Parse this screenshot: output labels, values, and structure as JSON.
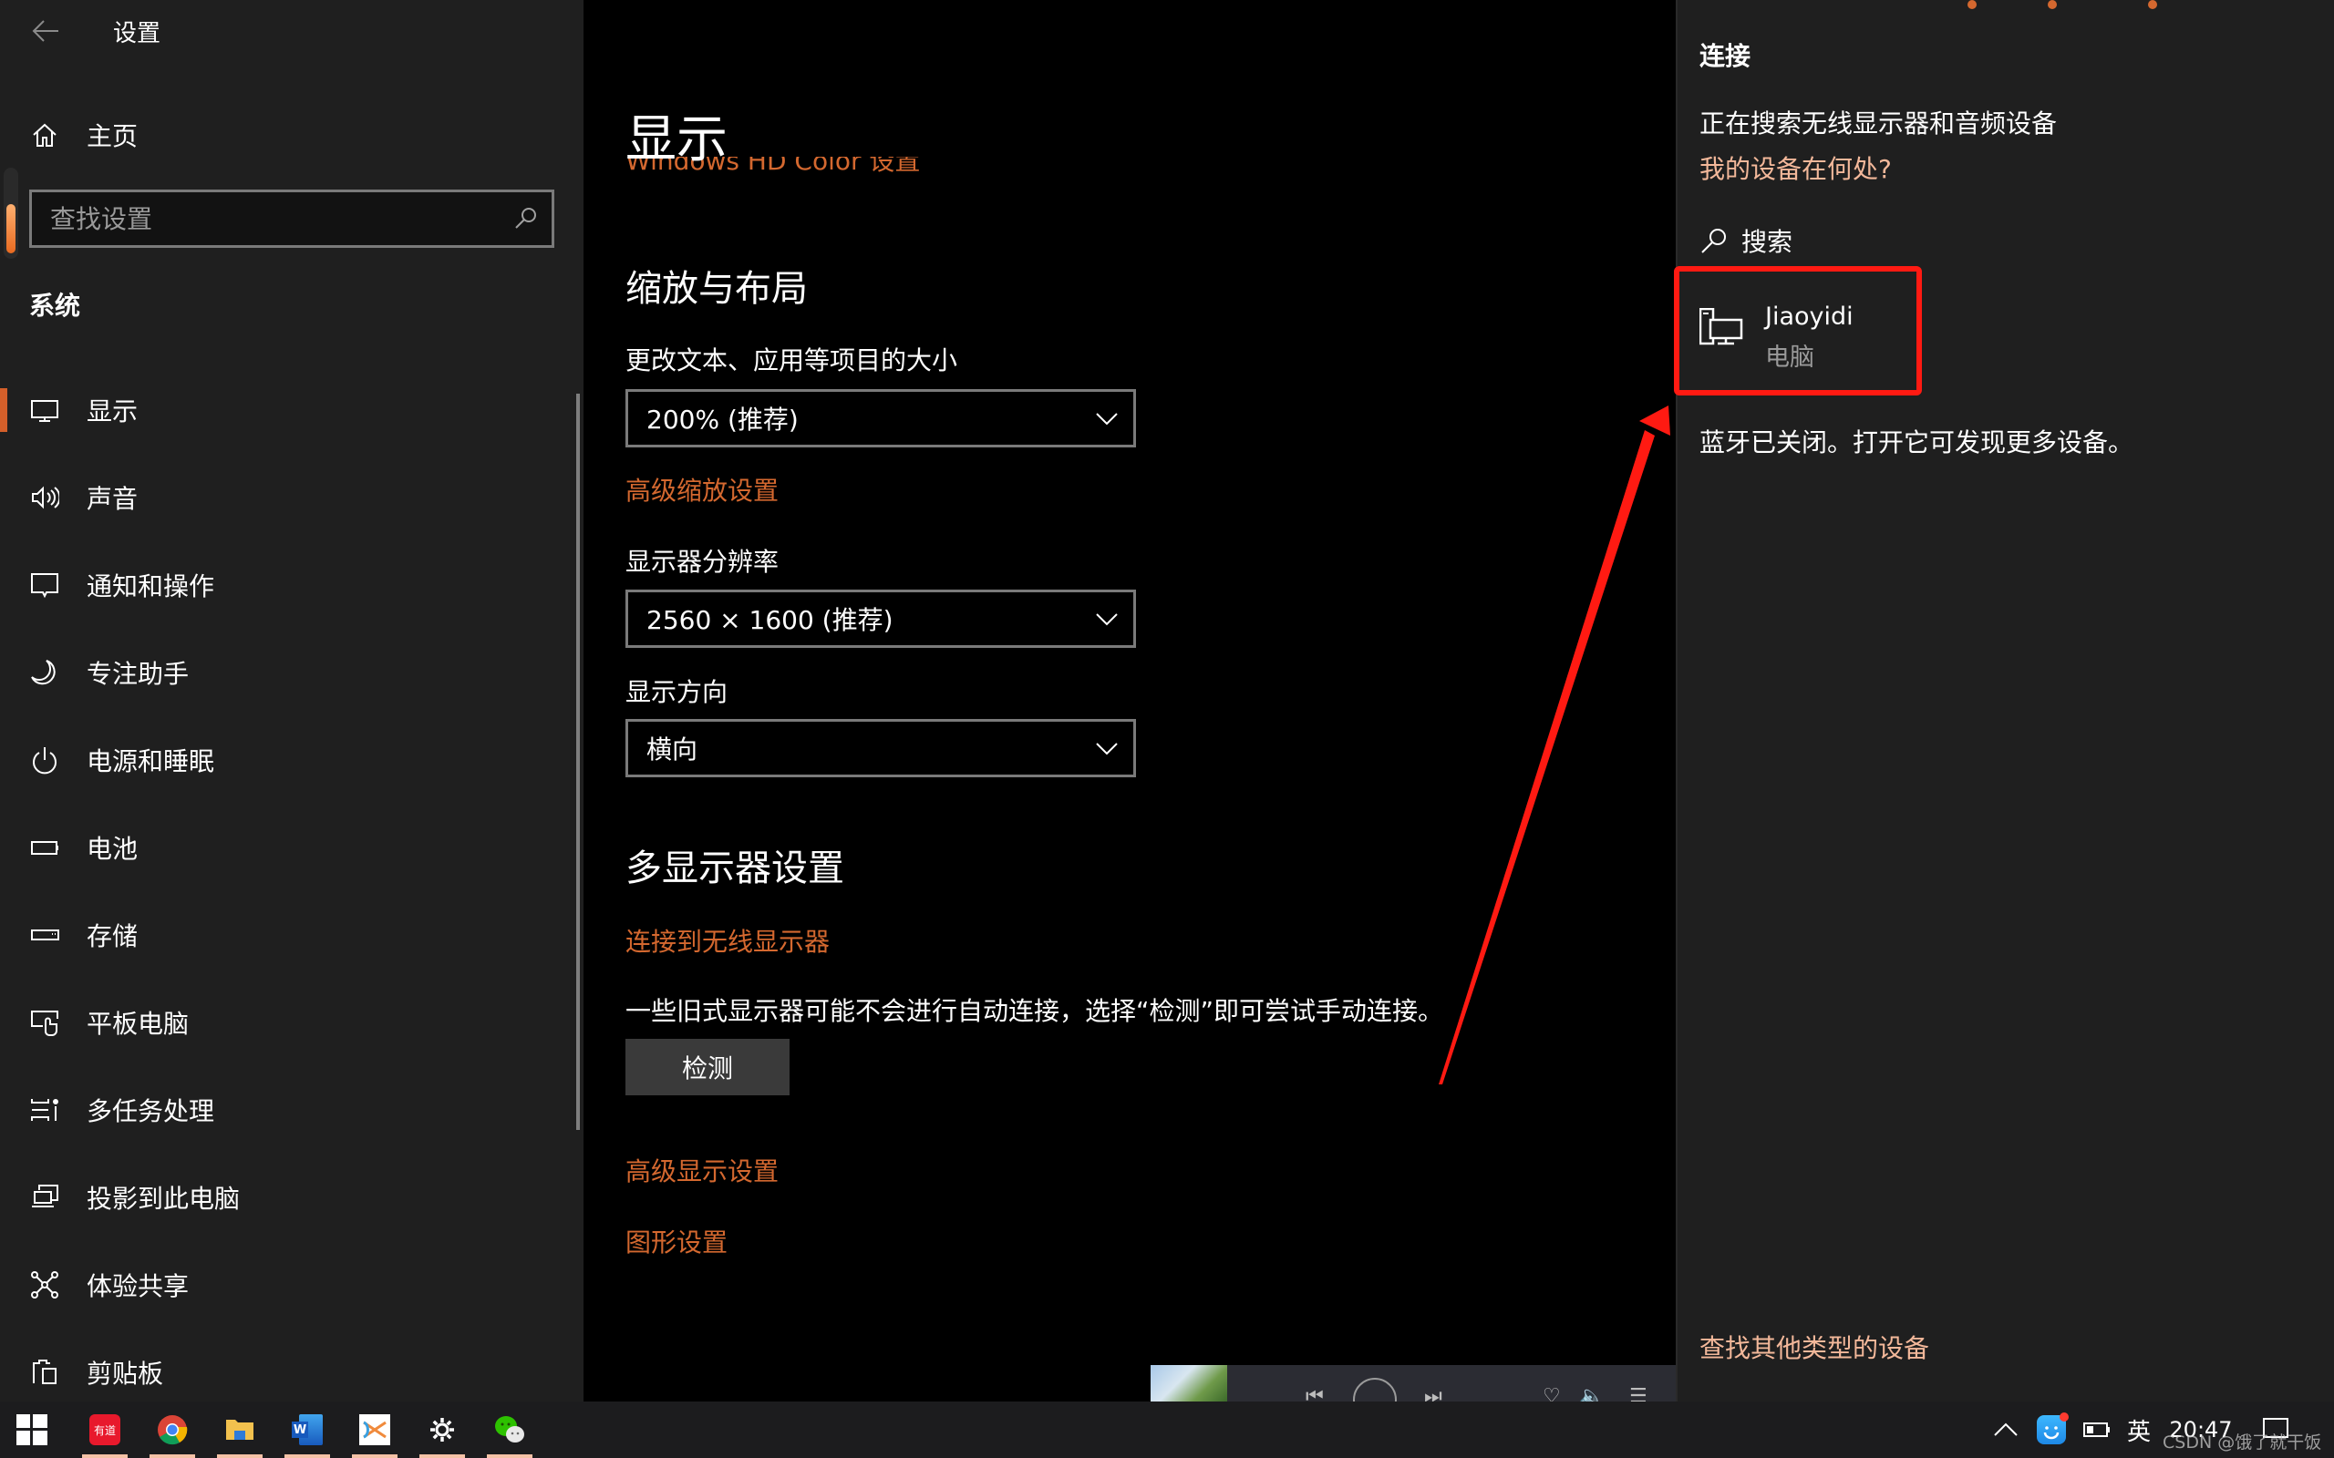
{
  "sidebar": {
    "title": "设置",
    "home_label": "主页",
    "search_placeholder": "查找设置",
    "section_label": "系统",
    "items": [
      {
        "label": "显示",
        "icon": "monitor-icon",
        "active": true
      },
      {
        "label": "声音",
        "icon": "speaker-icon"
      },
      {
        "label": "通知和操作",
        "icon": "notification-icon"
      },
      {
        "label": "专注助手",
        "icon": "moon-icon"
      },
      {
        "label": "电源和睡眠",
        "icon": "power-icon"
      },
      {
        "label": "电池",
        "icon": "battery-icon"
      },
      {
        "label": "存储",
        "icon": "storage-icon"
      },
      {
        "label": "平板电脑",
        "icon": "tablet-icon"
      },
      {
        "label": "多任务处理",
        "icon": "multitasking-icon"
      },
      {
        "label": "投影到此电脑",
        "icon": "project-icon"
      },
      {
        "label": "体验共享",
        "icon": "share-icon"
      },
      {
        "label": "剪贴板",
        "icon": "clipboard-icon"
      }
    ]
  },
  "content": {
    "page_title": "显示",
    "hdcolor_link": "Windows HD Color 设置",
    "scale_section": "缩放与布局",
    "scale_label": "更改文本、应用等项目的大小",
    "scale_value": "200% (推荐)",
    "advanced_scale_link": "高级缩放设置",
    "resolution_label": "显示器分辨率",
    "resolution_value": "2560 × 1600 (推荐)",
    "orientation_label": "显示方向",
    "orientation_value": "横向",
    "multi_section": "多显示器设置",
    "wireless_link": "连接到无线显示器",
    "detect_desc": "一些旧式显示器可能不会进行自动连接，选择“检测”即可尝试手动连接。",
    "detect_button": "检测",
    "advanced_display_link": "高级显示设置",
    "graphics_link": "图形设置"
  },
  "connect_panel": {
    "title": "连接",
    "status": "正在搜索无线显示器和音频设备",
    "where_link": "我的设备在何处?",
    "search_label": "搜索",
    "device": {
      "name": "Jiaoyidi",
      "type": "电脑",
      "icon": "pc-icon"
    },
    "bluetooth_msg": "蓝牙已关闭。打开它可发现更多设备。",
    "find_other_link": "查找其他类型的设备"
  },
  "taskbar": {
    "apps": [
      {
        "name": "youdao",
        "label": "有道",
        "color": "#e8192c"
      },
      {
        "name": "chrome"
      },
      {
        "name": "file-explorer"
      },
      {
        "name": "word",
        "label": "W"
      },
      {
        "name": "xmind"
      },
      {
        "name": "settings"
      },
      {
        "name": "wechat"
      }
    ],
    "ime": "英",
    "time": "20:47"
  },
  "watermark": "CSDN @饿了就干饭",
  "colors": {
    "accent": "#d4682f",
    "link_light": "#f3b89a",
    "annotation": "#ff1a12",
    "sidebar_bg": "#1f1f1f",
    "content_bg": "#000000"
  }
}
